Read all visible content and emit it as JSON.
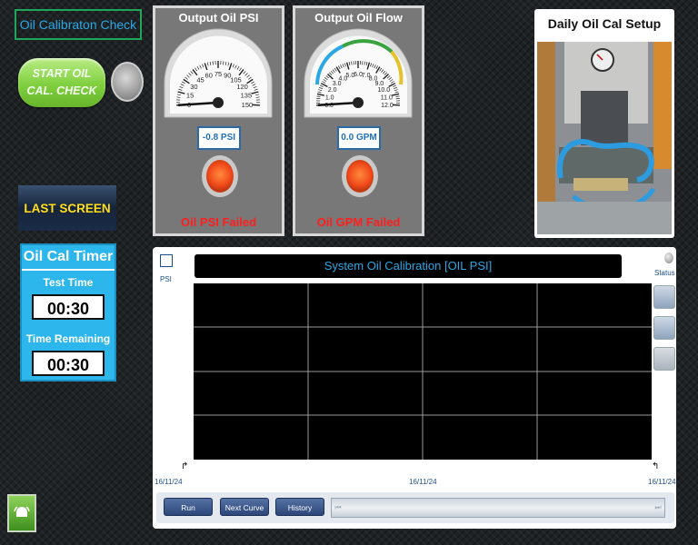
{
  "title": "Oil Calibraton Check",
  "start_button": {
    "line1": "START OIL",
    "line2": "CAL. CHECK"
  },
  "last_screen_button": "LAST SCREEN",
  "timer": {
    "title": "Oil Cal Timer",
    "test_time_label": "Test Time",
    "test_time_value": "00:30",
    "remaining_label": "Time Remaining",
    "remaining_value": "00:30"
  },
  "gauge_psi": {
    "title": "Output Oil PSI",
    "ticks": [
      "0",
      "15",
      "30",
      "45",
      "60",
      "75",
      "90",
      "105",
      "120",
      "135",
      "150"
    ],
    "readout": "-0.8 PSI",
    "status": "Oil PSI Failed",
    "min": 0,
    "max": 150,
    "value": -0.8
  },
  "gauge_gpm": {
    "title": "Output Oil Flow",
    "ticks": [
      "0.0",
      "1.0",
      "2.0",
      "3.0",
      "4.0",
      "5.0",
      "6.0",
      "7.0",
      "8.0",
      "9.0",
      "10.0",
      "11.0",
      "12.0"
    ],
    "readout": "0.0 GPM",
    "status": "Oil GPM Failed",
    "min": 0,
    "max": 12,
    "value": 0.0
  },
  "setup_card": {
    "title": "Daily Oil Cal Setup"
  },
  "trend": {
    "title": "System Oil Calibration [OIL PSI]",
    "y_label": "PSI",
    "status_label": "Status",
    "x_start": "16/11/24",
    "x_mid": "16/11/24",
    "x_end": "16/11/24",
    "buttons": {
      "run": "Run",
      "next": "Next Curve",
      "history": "History"
    }
  },
  "colors": {
    "accent": "#2aa8e6",
    "fail": "#ff1e1e",
    "start_green": "#7fcf3e",
    "last_screen_text": "#ffe018"
  }
}
